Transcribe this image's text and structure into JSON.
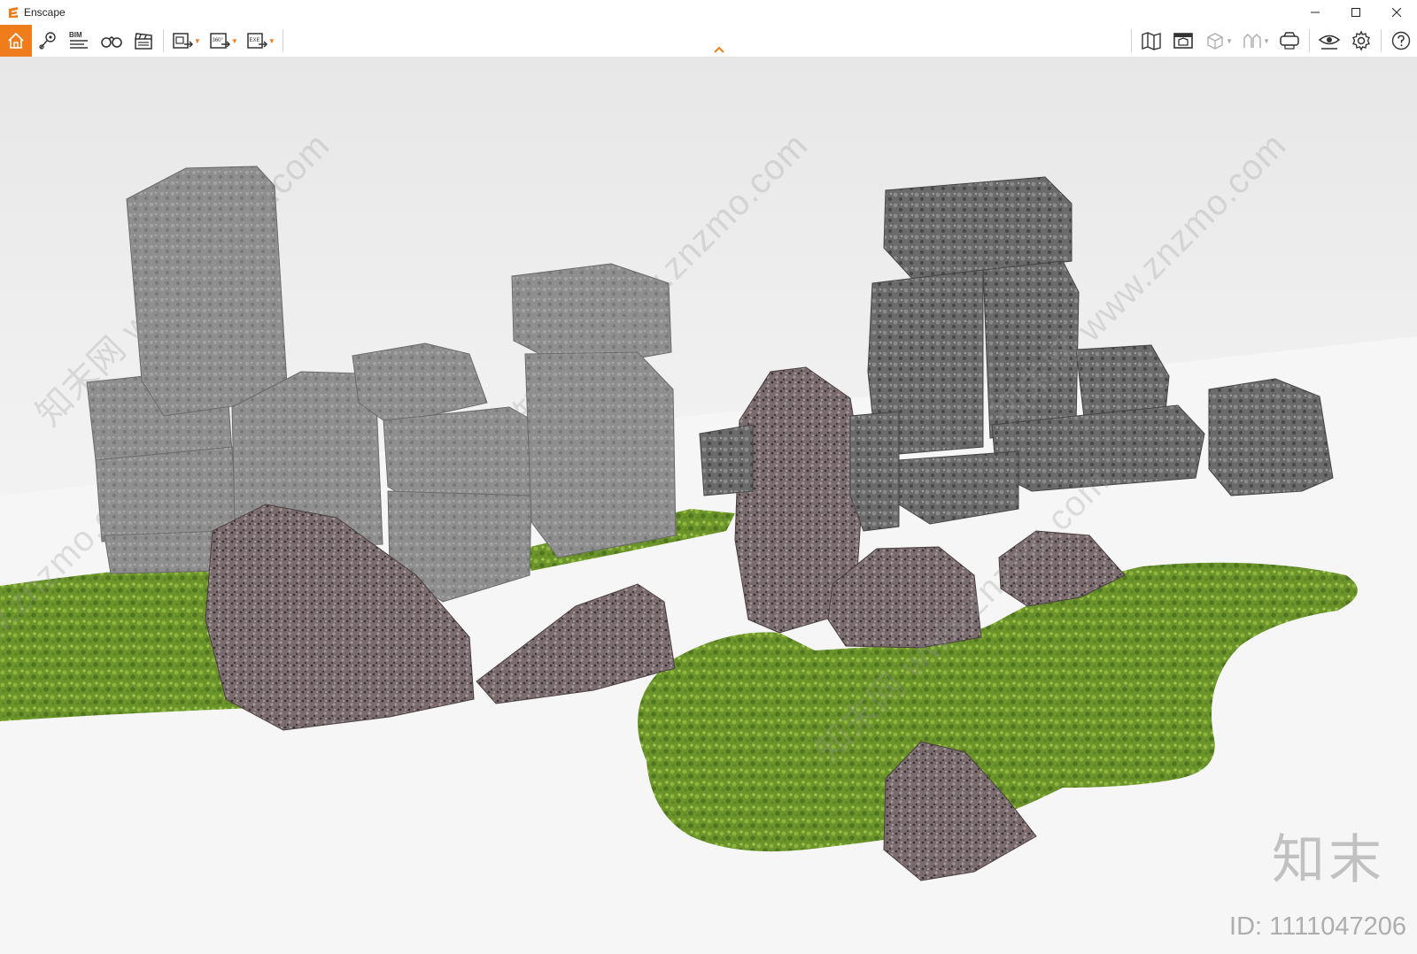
{
  "window": {
    "title": "Enscape"
  },
  "toolbar": {
    "left_tools": [
      "home-icon",
      "location-pin-icon",
      "bim-info-icon",
      "binoculars-icon",
      "clapper-icon",
      "screenshot-export-icon",
      "panorama-export-icon",
      "exe-export-icon"
    ],
    "bim_label": "BIM",
    "panorama_label": "360°",
    "exe_label": "EXE",
    "right_tools": [
      "map-icon",
      "asset-library-icon",
      "cube-view-icon",
      "collaborate-icon",
      "vr-headset-icon",
      "visibility-icon",
      "settings-icon",
      "help-icon"
    ]
  },
  "watermark": {
    "site_text": "知末网 www.znzmo.com",
    "brand": "知末",
    "id_text": "ID: 1111047206"
  },
  "colors": {
    "accent": "#f07d1c",
    "moss": "#6f9a2c",
    "stone": "#8c8c8c"
  }
}
